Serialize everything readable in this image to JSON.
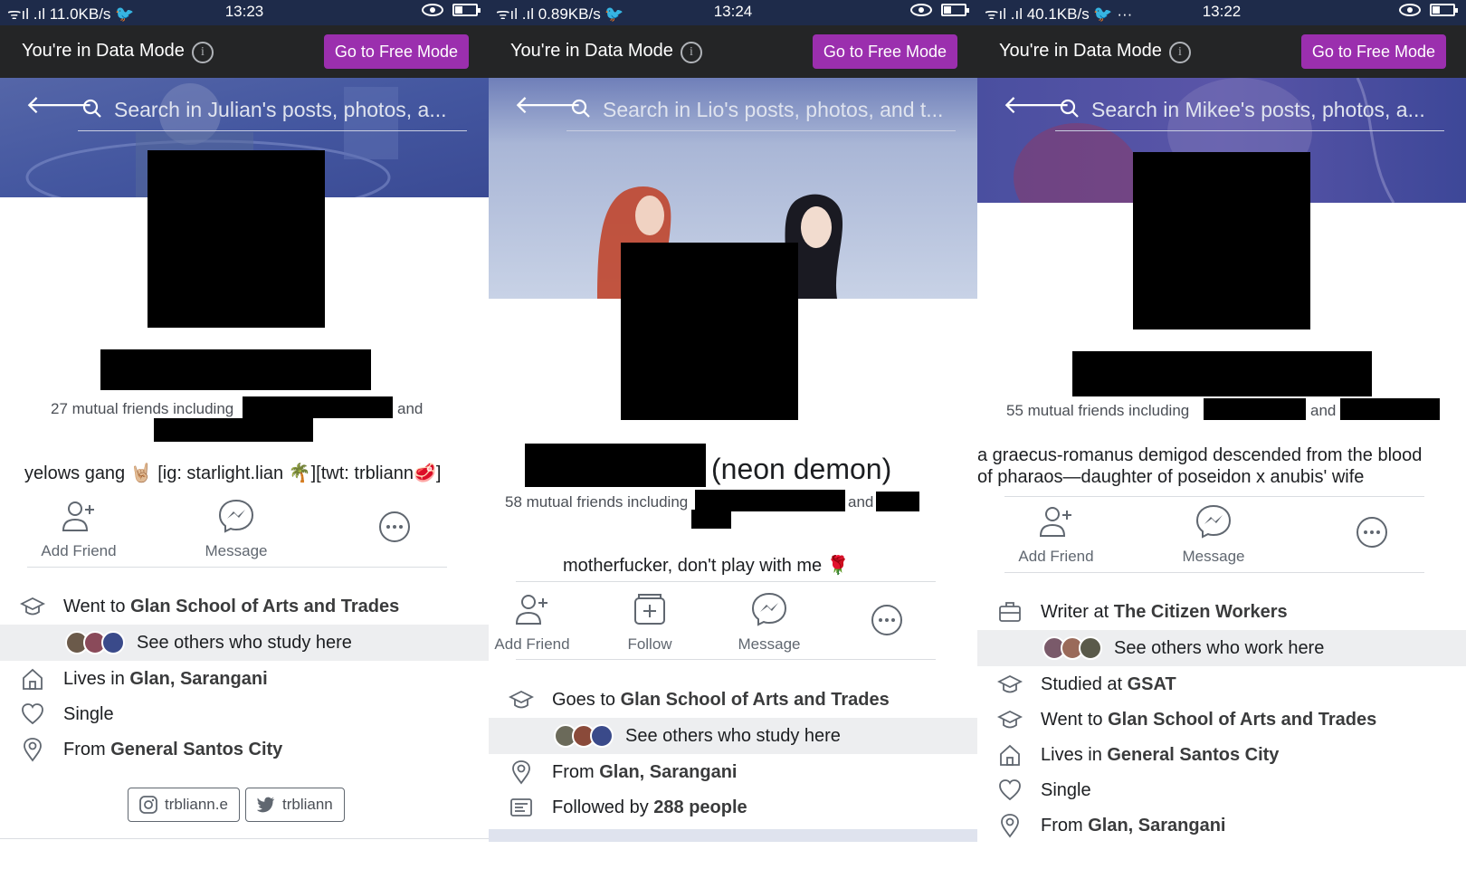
{
  "common": {
    "data_mode_text": "You're in Data Mode",
    "info_glyph": "i",
    "free_mode_button": "Go to Free Mode",
    "add_friend": "Add Friend",
    "message": "Message",
    "follow": "Follow"
  },
  "p1": {
    "status": {
      "speed": "11.0KB/s",
      "time": "13:23"
    },
    "search_placeholder": "Search in Julian's posts, photos, a...",
    "mutual": {
      "prefix": "27 mutual friends including",
      "and": "and"
    },
    "bio": "yelows gang 🤘🏼 [ig: starlight.lian 🌴][twt: trbliann🥩]",
    "education": {
      "prefix": "Went to ",
      "place": "Glan School of Arts and Trades"
    },
    "see_others": "See others who study here",
    "lives": {
      "prefix": "Lives in ",
      "place": "Glan, Sarangani"
    },
    "relationship": "Single",
    "from": {
      "prefix": "From ",
      "place": "General Santos City"
    },
    "instagram": "trbliann.e",
    "twitter": "trbliann"
  },
  "p2": {
    "status": {
      "speed": "0.89KB/s",
      "time": "13:24"
    },
    "search_placeholder": "Search in Lio's posts, photos, and t...",
    "name_suffix": "(neon demon)",
    "mutual": {
      "prefix": "58 mutual friends including",
      "and": "and"
    },
    "bio": "motherfucker, don't play with me 🌹",
    "education": {
      "prefix": "Goes to ",
      "place": "Glan School of Arts and Trades"
    },
    "see_others": "See others who study here",
    "from": {
      "prefix": "From ",
      "place": "Glan, Sarangani"
    },
    "followed": {
      "prefix": "Followed by ",
      "count": "288 people"
    }
  },
  "p3": {
    "status": {
      "speed": "40.1KB/s",
      "time": "13:22",
      "more": "···"
    },
    "search_placeholder": "Search in Mikee's posts, photos, a...",
    "mutual": {
      "prefix": "55 mutual friends including",
      "and": "and"
    },
    "bio_line1": "a graecus-romanus demigod descended from the blood",
    "bio_line2": "of pharaos—daughter of poseidon x anubis' wife",
    "work": {
      "prefix": "Writer at ",
      "place": "The Citizen Workers"
    },
    "see_others": "See others who work here",
    "studied": {
      "prefix": "Studied at ",
      "place": "GSAT"
    },
    "went": {
      "prefix": "Went to ",
      "place": "Glan School of Arts and Trades"
    },
    "lives": {
      "prefix": "Lives in ",
      "place": "General Santos City"
    },
    "relationship": "Single",
    "from": {
      "prefix": "From ",
      "place": "Glan, Sarangani"
    }
  },
  "colors": {
    "status_bar": "#1e2b4a",
    "data_bar": "#242526",
    "free_mode_button": "#9b2fae",
    "cover_tint": "#3d4fa0"
  }
}
